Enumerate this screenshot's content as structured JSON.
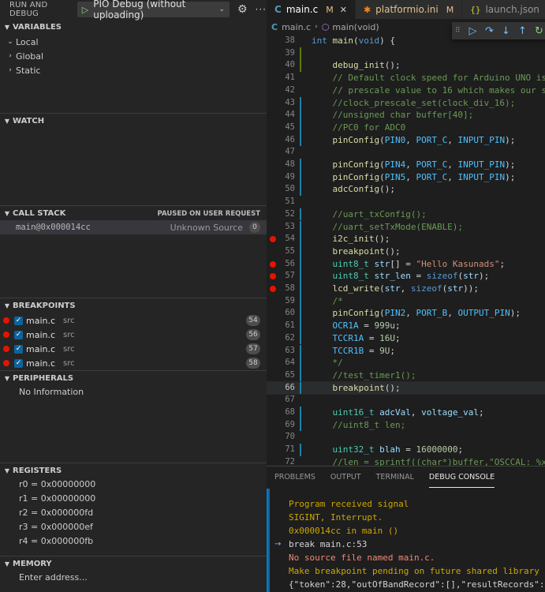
{
  "sidebar": {
    "header": {
      "title": "RUN AND DEBUG",
      "launch_config": "PIO Debug (without uploading)"
    },
    "variables": {
      "label": "VARIABLES",
      "items": [
        "Local",
        "Global",
        "Static"
      ]
    },
    "watch": {
      "label": "WATCH"
    },
    "call_stack": {
      "label": "CALL STACK",
      "status": "PAUSED ON USER REQUEST",
      "frames": [
        {
          "name": "main@0x000014cc",
          "source": "Unknown Source",
          "line": "0"
        }
      ]
    },
    "breakpoints": {
      "label": "BREAKPOINTS",
      "items": [
        {
          "file": "main.c",
          "dir": "src",
          "line": "54"
        },
        {
          "file": "main.c",
          "dir": "src",
          "line": "56"
        },
        {
          "file": "main.c",
          "dir": "src",
          "line": "57"
        },
        {
          "file": "main.c",
          "dir": "src",
          "line": "58"
        }
      ]
    },
    "peripherals": {
      "label": "PERIPHERALS",
      "empty": "No Information"
    },
    "registers": {
      "label": "REGISTERS",
      "items": [
        "r0 = 0x00000000",
        "r1 = 0x00000000",
        "r2 = 0x000000fd",
        "r3 = 0x000000ef",
        "r4 = 0x000000fb"
      ]
    },
    "memory": {
      "label": "MEMORY",
      "placeholder": "Enter address..."
    }
  },
  "editor": {
    "tabs": [
      {
        "name": "main.c",
        "modified": "M",
        "active": true
      },
      {
        "name": "platformio.ini",
        "modified": "M",
        "active": false
      },
      {
        "name": "launch.json",
        "modified": "",
        "active": false
      }
    ],
    "breadcrumb": {
      "file": "main.c",
      "symbol": "main(void)"
    },
    "current_line": 66,
    "breakpoint_lines": [
      54,
      56,
      57,
      58
    ],
    "lines": [
      {
        "n": "38",
        "text": "int main(void) {"
      },
      {
        "n": "39",
        "text": ""
      },
      {
        "n": "40",
        "text": "    debug_init();"
      },
      {
        "n": "41",
        "text": "    // Default clock speed for Arduino UNO is 16MHz"
      },
      {
        "n": "42",
        "text": "    // prescale value to 16 which makes our system clock"
      },
      {
        "n": "43",
        "text": "    //clock_prescale_set(clock_div_16);"
      },
      {
        "n": "44",
        "text": "    //unsigned char buffer[40];"
      },
      {
        "n": "45",
        "text": "    //PC0 for ADC0"
      },
      {
        "n": "46",
        "text": "    pinConfig(PIN0, PORT_C, INPUT_PIN);"
      },
      {
        "n": "47",
        "text": ""
      },
      {
        "n": "48",
        "text": "    pinConfig(PIN4, PORT_C, INPUT_PIN);"
      },
      {
        "n": "49",
        "text": "    pinConfig(PIN5, PORT_C, INPUT_PIN);"
      },
      {
        "n": "50",
        "text": "    adcConfig();"
      },
      {
        "n": "51",
        "text": ""
      },
      {
        "n": "52",
        "text": "    //uart_txConfig();"
      },
      {
        "n": "53",
        "text": "    //uart_setTxMode(ENABLE);"
      },
      {
        "n": "54",
        "text": "    i2c_init();"
      },
      {
        "n": "55",
        "text": "    breakpoint();"
      },
      {
        "n": "56",
        "text": "    uint8_t str[] = \"Hello Kasunads\";"
      },
      {
        "n": "57",
        "text": "    uint8_t str_len = sizeof(str);"
      },
      {
        "n": "58",
        "text": "    lcd_write(str, sizeof(str));"
      },
      {
        "n": "59",
        "text": "    /*"
      },
      {
        "n": "60",
        "text": "    pinConfig(PIN2, PORT_B, OUTPUT_PIN);"
      },
      {
        "n": "61",
        "text": "    OCR1A = 999u;"
      },
      {
        "n": "62",
        "text": "    TCCR1A = 16U;"
      },
      {
        "n": "63",
        "text": "    TCCR1B = 9U;"
      },
      {
        "n": "64",
        "text": "    */"
      },
      {
        "n": "65",
        "text": "    //test_timer1();"
      },
      {
        "n": "66",
        "text": "    breakpoint();"
      },
      {
        "n": "67",
        "text": ""
      },
      {
        "n": "68",
        "text": "    uint16_t adcVal, voltage_val;"
      },
      {
        "n": "69",
        "text": "    //uint8_t len;"
      },
      {
        "n": "70",
        "text": ""
      },
      {
        "n": "71",
        "text": "    uint32_t blah = 16000000;"
      },
      {
        "n": "72",
        "text": "    //len = sprintf((char*)buffer,\"OSCCAL: %x\\n\""
      }
    ]
  },
  "panel": {
    "tabs": [
      "PROBLEMS",
      "OUTPUT",
      "TERMINAL",
      "DEBUG CONSOLE"
    ],
    "active_tab": "DEBUG CONSOLE",
    "console": [
      {
        "text": "Program received signal",
        "kind": "yellow"
      },
      {
        "text": "SIGINT, Interrupt.",
        "kind": "yellow"
      },
      {
        "text": "0x000014cc in main ()",
        "kind": "yellow"
      },
      {
        "text": "break main.c:53",
        "kind": "white",
        "prompt": true
      },
      {
        "text": "No source file named main.c.",
        "kind": "red"
      },
      {
        "text": "Make breakpoint pending on future shared library load",
        "kind": "yellow"
      },
      {
        "text": "{\"token\":28,\"outOfBandRecord\":[],\"resultRecords\":{\"resultClass\"",
        "kind": "white"
      }
    ]
  },
  "colors": {
    "breakpoint": "#e51400",
    "accent": "#007acc",
    "modified": "#e2c08d"
  }
}
